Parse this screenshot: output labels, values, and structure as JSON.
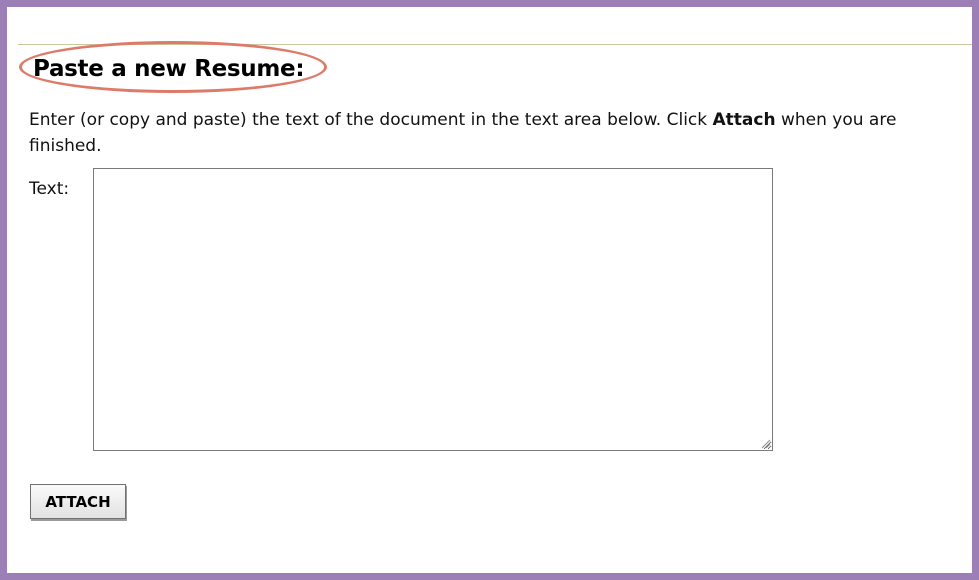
{
  "form": {
    "heading": "Paste a new Resume:",
    "instructions_part1": "Enter (or copy and paste) the text of the document in the text area below. Click ",
    "instructions_bold": "Attach",
    "instructions_part2": " when you are finished.",
    "text_label": "Text:",
    "text_value": "",
    "attach_label": "ATTACH"
  },
  "colors": {
    "frame_border": "#9b7fb6",
    "highlight_ellipse": "#dd7b6a",
    "top_rule": "#c9c7a0"
  },
  "icons": {
    "resize_grip": "resize-grip-icon"
  }
}
